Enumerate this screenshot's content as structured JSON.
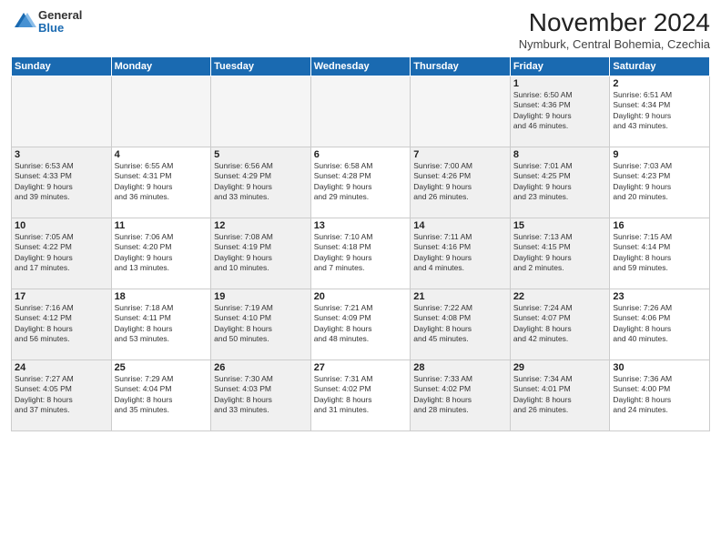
{
  "logo": {
    "general": "General",
    "blue": "Blue"
  },
  "title": "November 2024",
  "location": "Nymburk, Central Bohemia, Czechia",
  "days_header": [
    "Sunday",
    "Monday",
    "Tuesday",
    "Wednesday",
    "Thursday",
    "Friday",
    "Saturday"
  ],
  "weeks": [
    [
      {
        "day": "",
        "info": "",
        "empty": true
      },
      {
        "day": "",
        "info": "",
        "empty": true
      },
      {
        "day": "",
        "info": "",
        "empty": true
      },
      {
        "day": "",
        "info": "",
        "empty": true
      },
      {
        "day": "",
        "info": "",
        "empty": true
      },
      {
        "day": "1",
        "info": "Sunrise: 6:50 AM\nSunset: 4:36 PM\nDaylight: 9 hours\nand 46 minutes.",
        "shaded": true
      },
      {
        "day": "2",
        "info": "Sunrise: 6:51 AM\nSunset: 4:34 PM\nDaylight: 9 hours\nand 43 minutes."
      }
    ],
    [
      {
        "day": "3",
        "info": "Sunrise: 6:53 AM\nSunset: 4:33 PM\nDaylight: 9 hours\nand 39 minutes.",
        "shaded": true
      },
      {
        "day": "4",
        "info": "Sunrise: 6:55 AM\nSunset: 4:31 PM\nDaylight: 9 hours\nand 36 minutes."
      },
      {
        "day": "5",
        "info": "Sunrise: 6:56 AM\nSunset: 4:29 PM\nDaylight: 9 hours\nand 33 minutes.",
        "shaded": true
      },
      {
        "day": "6",
        "info": "Sunrise: 6:58 AM\nSunset: 4:28 PM\nDaylight: 9 hours\nand 29 minutes."
      },
      {
        "day": "7",
        "info": "Sunrise: 7:00 AM\nSunset: 4:26 PM\nDaylight: 9 hours\nand 26 minutes.",
        "shaded": true
      },
      {
        "day": "8",
        "info": "Sunrise: 7:01 AM\nSunset: 4:25 PM\nDaylight: 9 hours\nand 23 minutes.",
        "shaded": true
      },
      {
        "day": "9",
        "info": "Sunrise: 7:03 AM\nSunset: 4:23 PM\nDaylight: 9 hours\nand 20 minutes."
      }
    ],
    [
      {
        "day": "10",
        "info": "Sunrise: 7:05 AM\nSunset: 4:22 PM\nDaylight: 9 hours\nand 17 minutes.",
        "shaded": true
      },
      {
        "day": "11",
        "info": "Sunrise: 7:06 AM\nSunset: 4:20 PM\nDaylight: 9 hours\nand 13 minutes."
      },
      {
        "day": "12",
        "info": "Sunrise: 7:08 AM\nSunset: 4:19 PM\nDaylight: 9 hours\nand 10 minutes.",
        "shaded": true
      },
      {
        "day": "13",
        "info": "Sunrise: 7:10 AM\nSunset: 4:18 PM\nDaylight: 9 hours\nand 7 minutes."
      },
      {
        "day": "14",
        "info": "Sunrise: 7:11 AM\nSunset: 4:16 PM\nDaylight: 9 hours\nand 4 minutes.",
        "shaded": true
      },
      {
        "day": "15",
        "info": "Sunrise: 7:13 AM\nSunset: 4:15 PM\nDaylight: 9 hours\nand 2 minutes.",
        "shaded": true
      },
      {
        "day": "16",
        "info": "Sunrise: 7:15 AM\nSunset: 4:14 PM\nDaylight: 8 hours\nand 59 minutes."
      }
    ],
    [
      {
        "day": "17",
        "info": "Sunrise: 7:16 AM\nSunset: 4:12 PM\nDaylight: 8 hours\nand 56 minutes.",
        "shaded": true
      },
      {
        "day": "18",
        "info": "Sunrise: 7:18 AM\nSunset: 4:11 PM\nDaylight: 8 hours\nand 53 minutes."
      },
      {
        "day": "19",
        "info": "Sunrise: 7:19 AM\nSunset: 4:10 PM\nDaylight: 8 hours\nand 50 minutes.",
        "shaded": true
      },
      {
        "day": "20",
        "info": "Sunrise: 7:21 AM\nSunset: 4:09 PM\nDaylight: 8 hours\nand 48 minutes."
      },
      {
        "day": "21",
        "info": "Sunrise: 7:22 AM\nSunset: 4:08 PM\nDaylight: 8 hours\nand 45 minutes.",
        "shaded": true
      },
      {
        "day": "22",
        "info": "Sunrise: 7:24 AM\nSunset: 4:07 PM\nDaylight: 8 hours\nand 42 minutes.",
        "shaded": true
      },
      {
        "day": "23",
        "info": "Sunrise: 7:26 AM\nSunset: 4:06 PM\nDaylight: 8 hours\nand 40 minutes."
      }
    ],
    [
      {
        "day": "24",
        "info": "Sunrise: 7:27 AM\nSunset: 4:05 PM\nDaylight: 8 hours\nand 37 minutes.",
        "shaded": true
      },
      {
        "day": "25",
        "info": "Sunrise: 7:29 AM\nSunset: 4:04 PM\nDaylight: 8 hours\nand 35 minutes."
      },
      {
        "day": "26",
        "info": "Sunrise: 7:30 AM\nSunset: 4:03 PM\nDaylight: 8 hours\nand 33 minutes.",
        "shaded": true
      },
      {
        "day": "27",
        "info": "Sunrise: 7:31 AM\nSunset: 4:02 PM\nDaylight: 8 hours\nand 31 minutes."
      },
      {
        "day": "28",
        "info": "Sunrise: 7:33 AM\nSunset: 4:02 PM\nDaylight: 8 hours\nand 28 minutes.",
        "shaded": true
      },
      {
        "day": "29",
        "info": "Sunrise: 7:34 AM\nSunset: 4:01 PM\nDaylight: 8 hours\nand 26 minutes.",
        "shaded": true
      },
      {
        "day": "30",
        "info": "Sunrise: 7:36 AM\nSunset: 4:00 PM\nDaylight: 8 hours\nand 24 minutes."
      }
    ]
  ]
}
